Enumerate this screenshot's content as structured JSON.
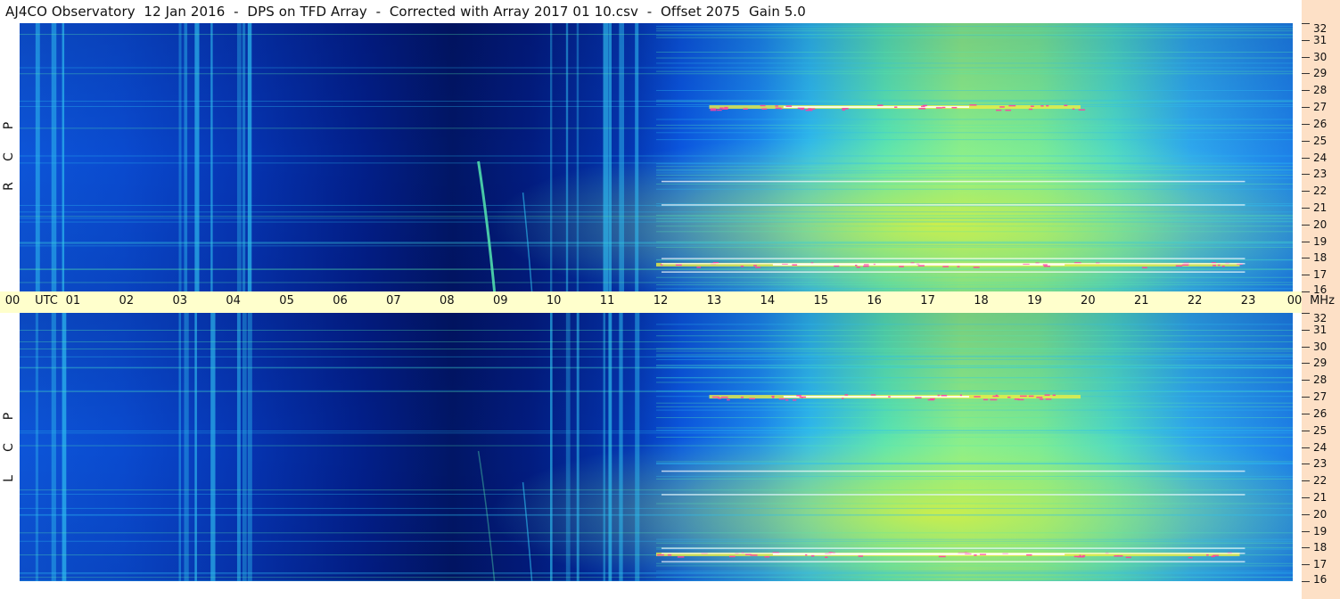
{
  "title": "AJ4CO Observatory  12 Jan 2016  -  DPS on TFD Array  -  Corrected with Array 2017 01 10.csv  -  Offset 2075  Gain 5.0",
  "panels": {
    "top_label": [
      "R",
      "C",
      "P"
    ],
    "bottom_label": [
      "L",
      "C",
      "P"
    ]
  },
  "time_axis": {
    "ticks": [
      "00",
      "01",
      "02",
      "03",
      "04",
      "05",
      "06",
      "07",
      "08",
      "09",
      "10",
      "11",
      "12",
      "13",
      "14",
      "15",
      "16",
      "17",
      "18",
      "19",
      "20",
      "21",
      "22",
      "23",
      "00"
    ],
    "unit_left": "UTC",
    "unit_right": "MHz"
  },
  "freq_axis": {
    "ticks": [
      "32",
      "31",
      "30",
      "29",
      "28",
      "27",
      "26",
      "25",
      "24",
      "23",
      "22",
      "21",
      "20",
      "19",
      "18",
      "17",
      "16"
    ],
    "range_mhz": [
      16,
      32
    ]
  },
  "chart_data": {
    "type": "heatmap",
    "title": "AJ4CO Observatory  12 Jan 2016  -  DPS on TFD Array  -  Corrected with Array 2017 01 10.csv  -  Offset 2075  Gain 5.0",
    "x_range_utc_hours": [
      0,
      24
    ],
    "y_range_mhz": [
      16,
      32
    ],
    "panels": [
      "RCP",
      "LCP"
    ],
    "colormap": [
      "#001a7a",
      "#0a3fd6",
      "#1e7ef0",
      "#2fc0f0",
      "#55e8b0",
      "#b8f060",
      "#f0f040",
      "#ff40a0",
      "#ffffff"
    ],
    "features": [
      {
        "name": "daytime ionospheric band",
        "utc_start": 12,
        "utc_end": 23,
        "intensity": "high"
      },
      {
        "name": "night quiet",
        "utc_start": 4,
        "utc_end": 11.5,
        "intensity": "low"
      },
      {
        "name": "strong band 27 MHz",
        "mhz": 27,
        "utc_start": 13,
        "utc_end": 20
      },
      {
        "name": "strong band 17.6 MHz",
        "mhz": 17.6,
        "utc_start": 12,
        "utc_end": 23
      }
    ]
  }
}
